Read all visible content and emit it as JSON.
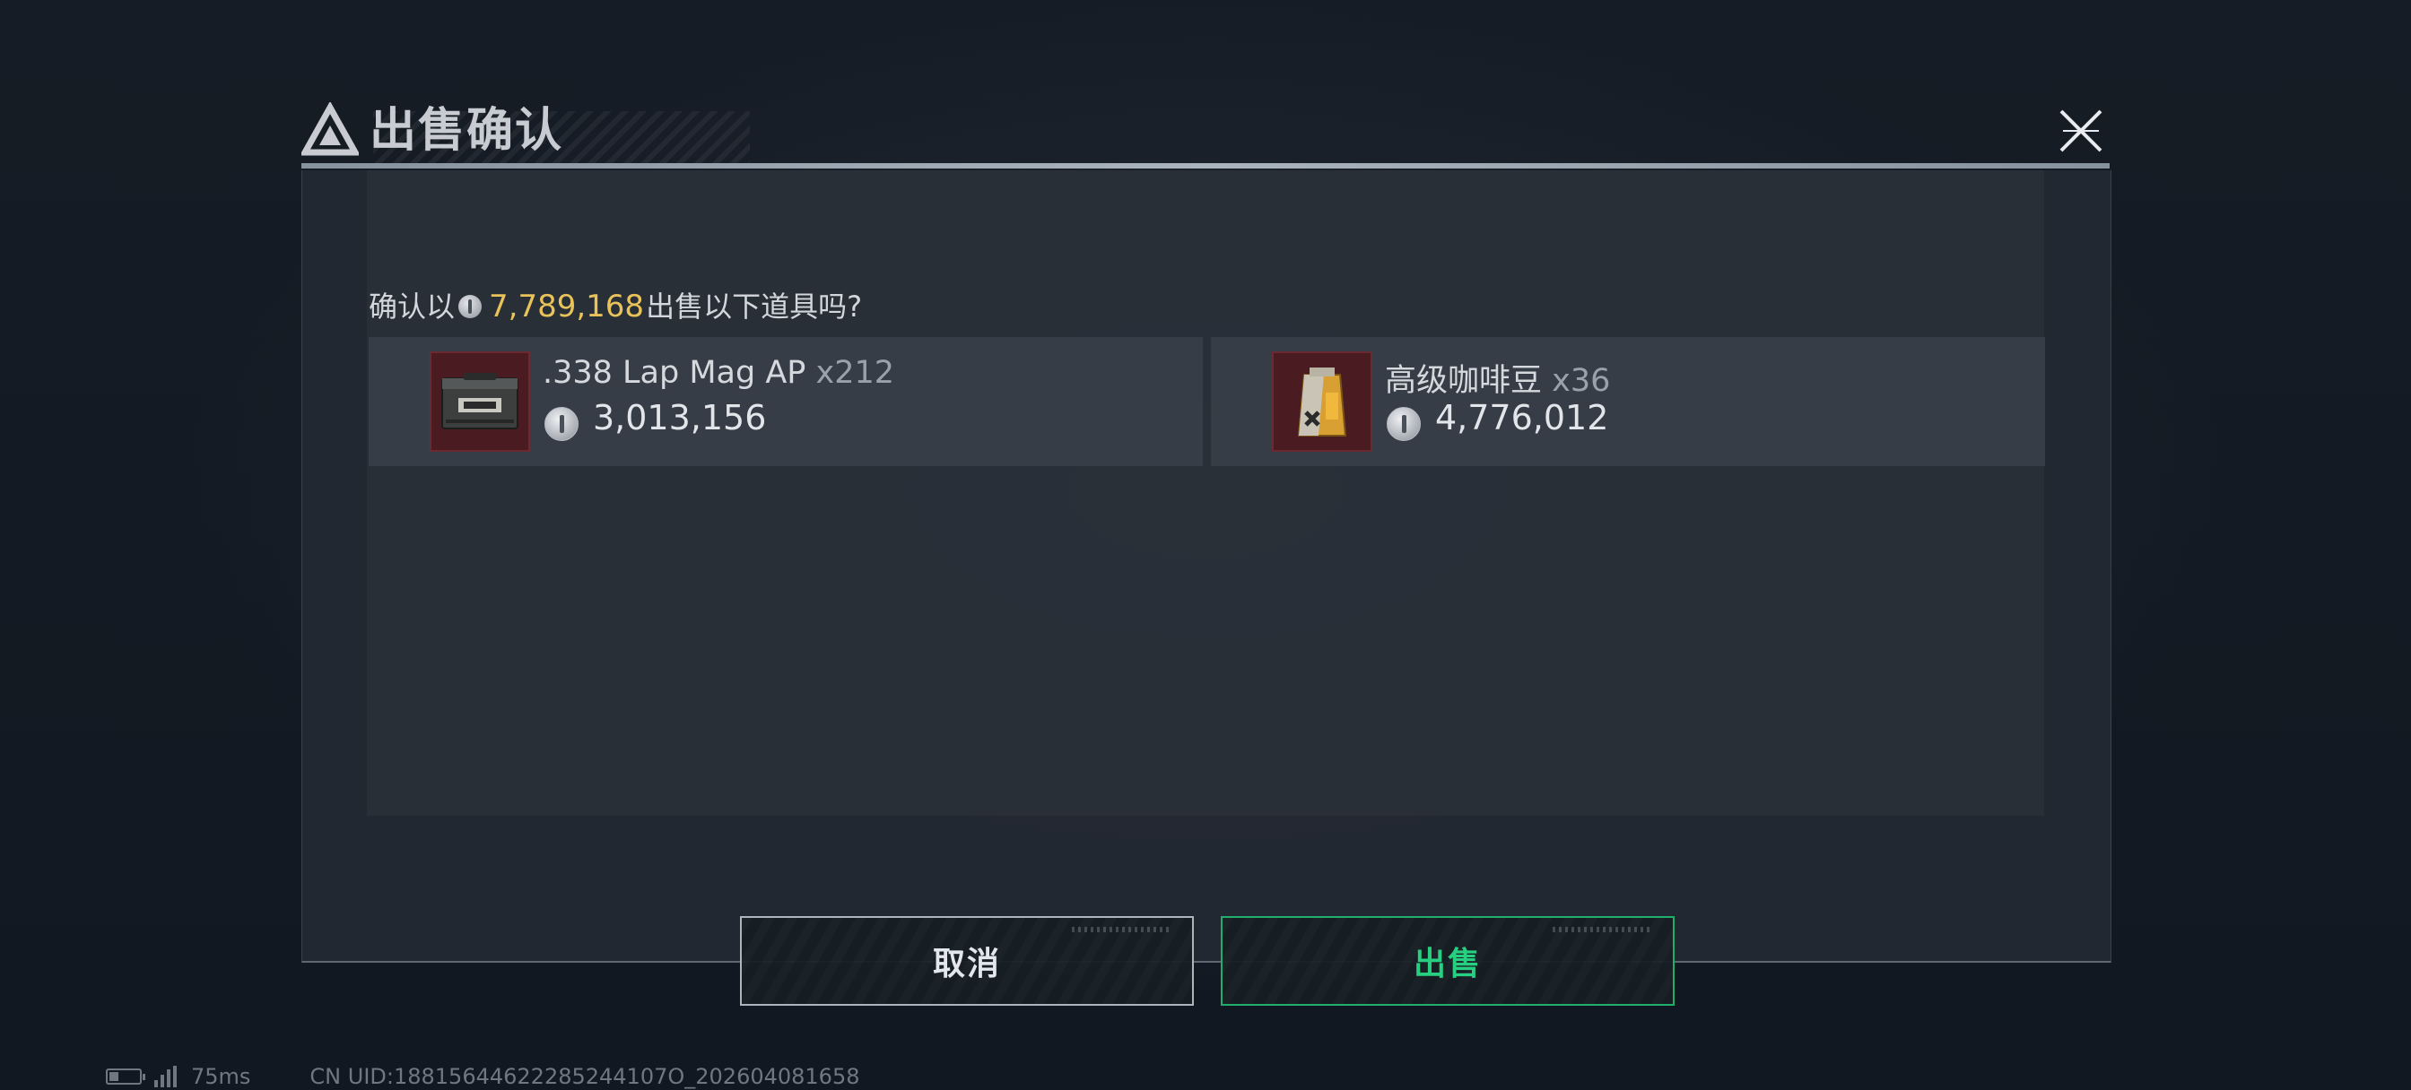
{
  "dialog": {
    "title": "出售确认",
    "prompt_prefix": "确认以",
    "total_price": "7,789,168",
    "prompt_suffix": "出售以下道具吗?",
    "items": [
      {
        "name": ".338 Lap Mag AP",
        "quantity": "x212",
        "price": "3,013,156",
        "icon": "ammo-box-icon"
      },
      {
        "name": "高级咖啡豆",
        "quantity": "x36",
        "price": "4,776,012",
        "icon": "coffee-bag-icon"
      }
    ],
    "cancel_label": "取消",
    "sell_label": "出售"
  },
  "footer": {
    "ping": "75ms",
    "uid": "CN UID:18815644622285244107O_202604081658"
  },
  "colors": {
    "accent_gold": "#e9c25a",
    "sell_green": "#27d080",
    "background": "#141a23"
  }
}
